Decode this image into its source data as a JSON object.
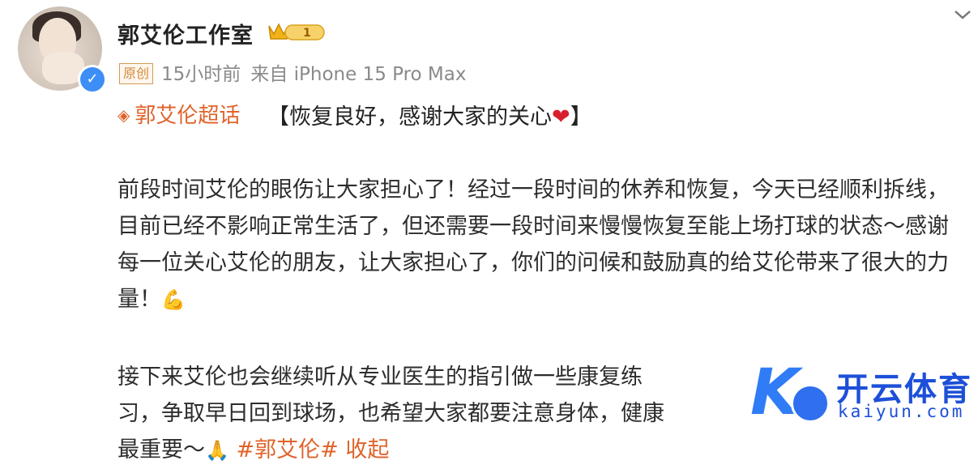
{
  "post": {
    "author": "郭艾伦工作室",
    "vip_level": "1",
    "original_tag": "原创",
    "time": "15小时前",
    "source": "来自 iPhone 15 Pro Max",
    "supertopic": "郭艾伦超话",
    "headline": "【恢复良好，感谢大家的关心",
    "headline_end": "】",
    "paragraph1": "前段时间艾伦的眼伤让大家担心了！经过一段时间的休养和恢复，今天已经顺利拆线，目前已经不影响正常生活了，但还需要一段时间来慢慢恢复至能上场打球的状态～感谢每一位关心艾伦的朋友，让大家担心了，你们的问候和鼓励真的给艾伦带来了很大的力量！",
    "paragraph2": "接下来艾伦也会继续听从专业医生的指引做一些康复练习，争取早日回到球场，也希望大家都要注意身体，健康最重要～",
    "topic_tag": "#郭艾伦#",
    "fold_label": "收起"
  },
  "watermark": {
    "name": "开云体育",
    "url": "kaiyun.com"
  },
  "icons": {
    "verified": "verified-badge-icon",
    "vip": "vip-crown-icon",
    "menu": "chevron-down-icon",
    "supertopic": "diamond-icon",
    "heart": "red-heart-emoji",
    "muscle": "flexed-biceps-emoji",
    "pray": "folded-hands-emoji"
  },
  "colors": {
    "accent": "#e0632a",
    "verified": "#3d8ef6",
    "watermark": "#2f7cf6"
  }
}
